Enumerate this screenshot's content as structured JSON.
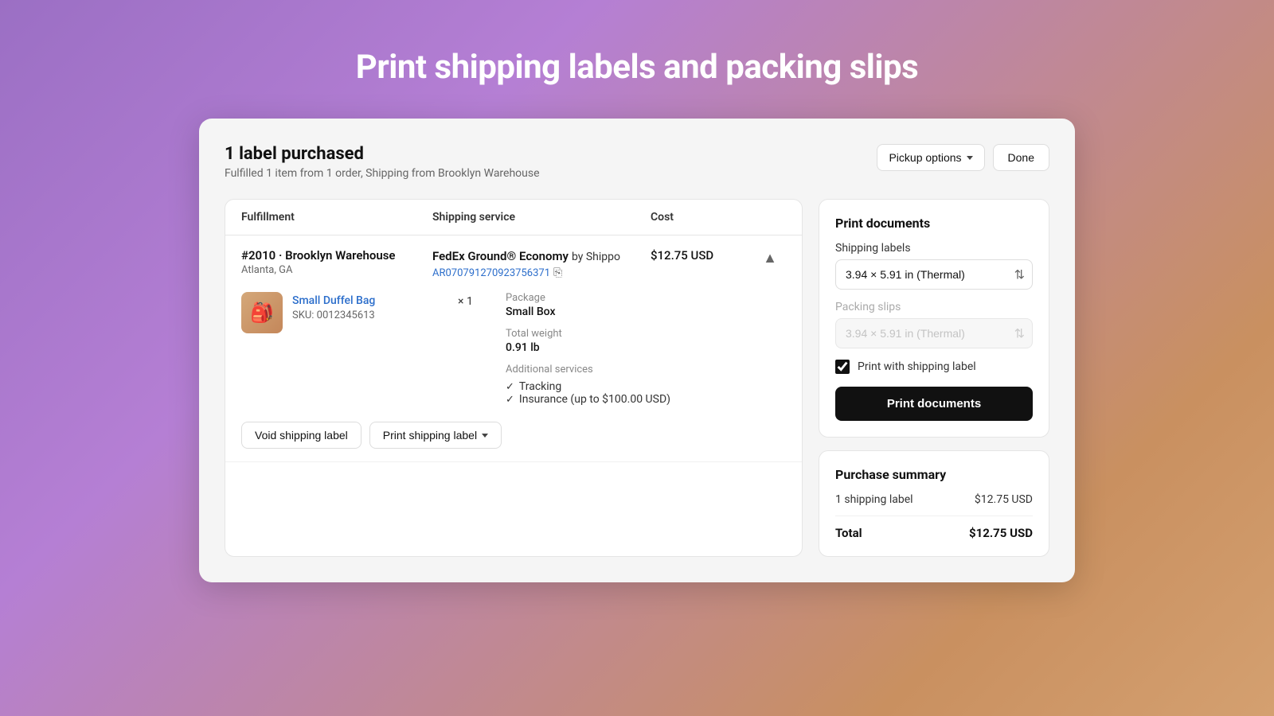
{
  "page": {
    "title": "Print shipping labels and packing slips"
  },
  "card": {
    "header": {
      "title": "1 label purchased",
      "subtitle": "Fulfilled 1 item from 1 order, Shipping from Brooklyn Warehouse",
      "pickup_options_label": "Pickup options",
      "done_label": "Done"
    }
  },
  "table": {
    "columns": [
      "Fulfillment",
      "Shipping service",
      "Cost",
      ""
    ],
    "row": {
      "fulfillment": "#2010 · Brooklyn Warehouse",
      "city": "Atlanta, GA",
      "shipping_service": "FedEx Ground® Economy",
      "shipping_service_suffix": " by Shippo",
      "tracking_number": "AR070791270923756371",
      "cost": "$12.75 USD",
      "item": {
        "name": "Small Duffel Bag",
        "sku": "SKU: 0012345613",
        "quantity": "× 1"
      },
      "package": {
        "label": "Package",
        "value": "Small Box"
      },
      "weight": {
        "label": "Total weight",
        "value": "0.91 lb"
      },
      "additional_services": {
        "label": "Additional services",
        "items": [
          "Tracking",
          "Insurance (up to $100.00 USD)"
        ]
      },
      "void_label": "Void shipping label",
      "print_label": "Print shipping label"
    }
  },
  "print_documents": {
    "section_title": "Print documents",
    "shipping_labels_label": "Shipping labels",
    "shipping_labels_value": "3.94 × 5.91 in (Thermal)",
    "packing_slips_label": "Packing slips",
    "packing_slips_value": "3.94 × 5.91 in (Thermal)",
    "checkbox_label": "Print with shipping label",
    "print_button_label": "Print documents"
  },
  "purchase_summary": {
    "section_title": "Purchase summary",
    "items": [
      {
        "label": "1 shipping label",
        "value": "$12.75 USD"
      }
    ],
    "total_label": "Total",
    "total_value": "$12.75 USD"
  }
}
